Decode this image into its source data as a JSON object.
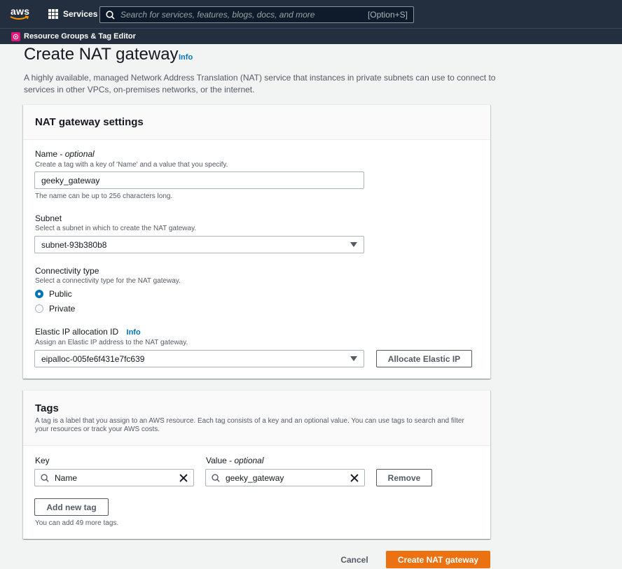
{
  "nav": {
    "logo": "aws",
    "services_label": "Services",
    "search_placeholder": "Search for services, features, blogs, docs, and more",
    "search_shortcut": "[Option+S]",
    "pinned_service": "Resource Groups & Tag Editor"
  },
  "page": {
    "title": "Create NAT gateway",
    "info": "Info",
    "description": "A highly available, managed Network Address Translation (NAT) service that instances in private subnets can use to connect to services in other VPCs, on-premises networks, or the internet."
  },
  "settings": {
    "title": "NAT gateway settings",
    "name": {
      "label": "Name - ",
      "optional": "optional",
      "description": "Create a tag with a key of 'Name' and a value that you specify.",
      "value": "geeky_gateway",
      "hint": "The name can be up to 256 characters long."
    },
    "subnet": {
      "label": "Subnet",
      "description": "Select a subnet in which to create the NAT gateway.",
      "value": "subnet-93b380b8"
    },
    "connectivity": {
      "label": "Connectivity type",
      "description": "Select a connectivity type for the NAT gateway.",
      "options": [
        "Public",
        "Private"
      ],
      "selected": "Public"
    },
    "eip": {
      "label": "Elastic IP allocation ID",
      "info": "Info",
      "description": "Assign an Elastic IP address to the NAT gateway.",
      "value": "eipalloc-005fe6f431e7fc639",
      "allocate_button": "Allocate Elastic IP"
    }
  },
  "tags": {
    "title": "Tags",
    "description": "A tag is a label that you assign to an AWS resource. Each tag consists of a key and an optional value. You can use tags to search and filter your resources or track your AWS costs.",
    "key_label": "Key",
    "value_label": "Value - ",
    "value_optional": "optional",
    "rows": [
      {
        "key": "Name",
        "value": "geeky_gateway"
      }
    ],
    "remove_button": "Remove",
    "add_button": "Add new tag",
    "limit_text": "You can add 49 more tags."
  },
  "footer": {
    "cancel": "Cancel",
    "submit": "Create NAT gateway"
  },
  "colors": {
    "nav_bg": "#232f3e",
    "primary": "#ec7211",
    "link": "#0073bb"
  }
}
